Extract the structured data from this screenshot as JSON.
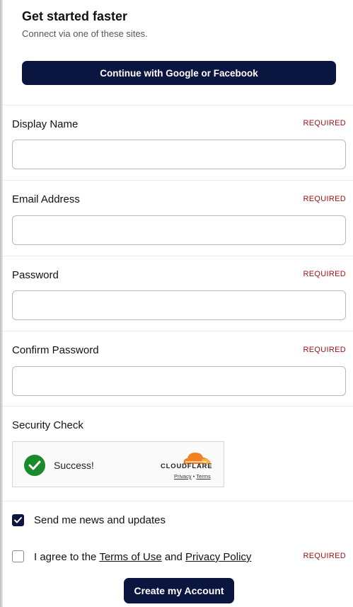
{
  "intro": {
    "title": "Get started faster",
    "subtitle": "Connect via one of these sites.",
    "social_button": "Continue with Google or Facebook"
  },
  "fields": {
    "display_name": {
      "label": "Display Name",
      "required": "REQUIRED",
      "value": ""
    },
    "email": {
      "label": "Email Address",
      "required": "REQUIRED",
      "value": ""
    },
    "password": {
      "label": "Password",
      "required": "REQUIRED",
      "value": ""
    },
    "confirm_password": {
      "label": "Confirm Password",
      "required": "REQUIRED",
      "value": ""
    }
  },
  "security": {
    "label": "Security Check",
    "status": "Success!",
    "provider": "CLOUDFLARE",
    "privacy_link": "Privacy",
    "separator": "•",
    "terms_link": "Terms"
  },
  "options": {
    "news": {
      "label": "Send me news and updates",
      "checked": true
    },
    "agree": {
      "prefix": "I agree to the",
      "terms_link": "Terms of Use",
      "and": "and",
      "privacy_link": "Privacy Policy",
      "required": "REQUIRED",
      "checked": false
    }
  },
  "submit_label": "Create my Account",
  "colors": {
    "primary": "#0b1640",
    "required": "#a31212",
    "success": "#1a8a2a",
    "cloudflare": "#f38020"
  }
}
